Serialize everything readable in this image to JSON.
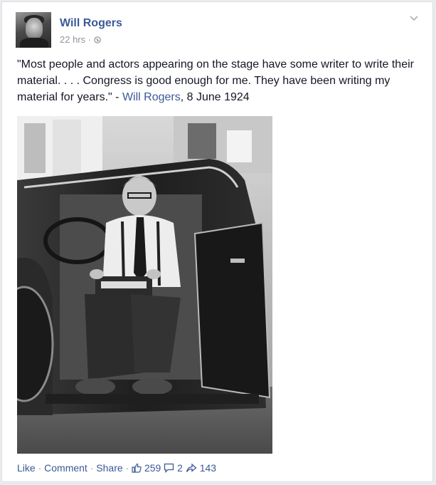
{
  "post": {
    "author": "Will Rogers",
    "time": "22 hrs",
    "time_sep": "·",
    "text_before": "\"Most people and actors appearing on the stage have some writer to write their material. . . . Congress is good enough for me. They have been writing my material for years.\" - ",
    "text_link": "Will Rogers",
    "text_after": ", 8 June 1924",
    "photo_icon": "photo-will-rogers-typewriter-car"
  },
  "actions": {
    "like": "Like",
    "comment": "Comment",
    "share": "Share",
    "sep": "·",
    "likes_count": "259",
    "comments_count": "2",
    "shares_count": "143",
    "like_icon": "thumbs-up-icon",
    "comment_icon": "comment-bubble-icon",
    "share_icon": "share-arrow-icon"
  },
  "colors": {
    "link": "#3b5998",
    "meta": "#90949c",
    "text": "#141823",
    "background": "#e9ebee"
  }
}
